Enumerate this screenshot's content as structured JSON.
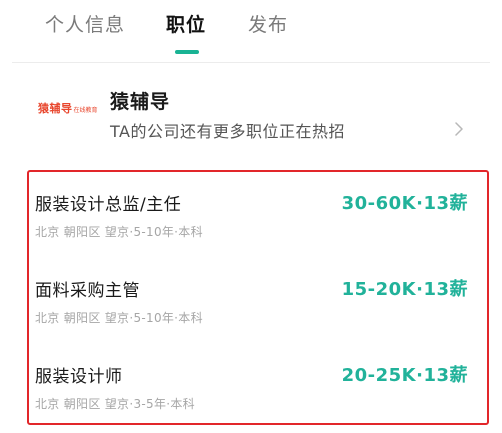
{
  "tabs": [
    {
      "label": "个人信息",
      "active": false
    },
    {
      "label": "职位",
      "active": true
    },
    {
      "label": "发布",
      "active": false
    }
  ],
  "accent_color": "#19b394",
  "company": {
    "logo_text": "猿辅导",
    "logo_subtext": "在线教育",
    "name": "猿辅导",
    "subtitle": "TA的公司还有更多职位正在热招",
    "chevron_icon": "chevron-right-icon"
  },
  "jobs": [
    {
      "title": "服装设计总监/主任",
      "salary": "30-60K·13薪",
      "meta": "北京 朝阳区 望京·5-10年·本科"
    },
    {
      "title": "面料采购主管",
      "salary": "15-20K·13薪",
      "meta": "北京 朝阳区 望京·5-10年·本科"
    },
    {
      "title": "服装设计师",
      "salary": "20-25K·13薪",
      "meta": "北京 朝阳区 望京·3-5年·本科"
    }
  ]
}
